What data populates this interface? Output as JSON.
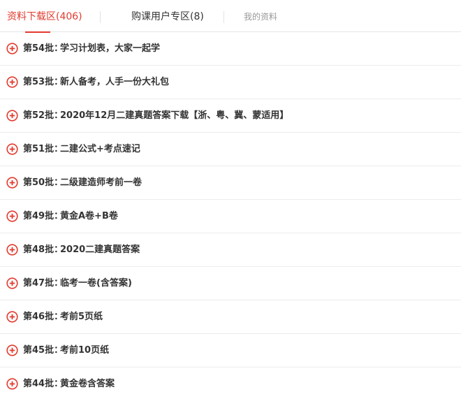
{
  "tabs": [
    {
      "label": "资料下载区(406)",
      "active": true
    },
    {
      "label": "购课用户专区(8)",
      "active": false
    },
    {
      "label": "我的资料",
      "active": false
    }
  ],
  "accent_color": "#e23a2e",
  "items": [
    {
      "batch": "第54批：",
      "title": "学习计划表，大家一起学",
      "icon": "plus-circle-icon"
    },
    {
      "batch": "第53批：",
      "title": "新人备考，人手一份大礼包",
      "icon": "plus-circle-icon"
    },
    {
      "batch": "第52批：",
      "title": "2020年12月二建真题答案下载【浙、粤、冀、蒙适用】",
      "icon": "plus-circle-icon"
    },
    {
      "batch": "第51批：",
      "title": "二建公式+考点速记",
      "icon": "plus-circle-icon"
    },
    {
      "batch": "第50批：",
      "title": "二级建造师考前一卷",
      "icon": "plus-circle-icon"
    },
    {
      "batch": "第49批：",
      "title": "黄金A卷+B卷",
      "icon": "plus-circle-icon"
    },
    {
      "batch": "第48批：",
      "title": "2020二建真题答案",
      "icon": "plus-circle-icon"
    },
    {
      "batch": "第47批：",
      "title": "临考一卷(含答案)",
      "icon": "plus-circle-icon"
    },
    {
      "batch": "第46批：",
      "title": "考前5页纸",
      "icon": "plus-circle-icon"
    },
    {
      "batch": "第45批：",
      "title": "考前10页纸",
      "icon": "plus-circle-icon"
    },
    {
      "batch": "第44批：",
      "title": "黄金卷含答案",
      "icon": "plus-circle-icon"
    }
  ]
}
